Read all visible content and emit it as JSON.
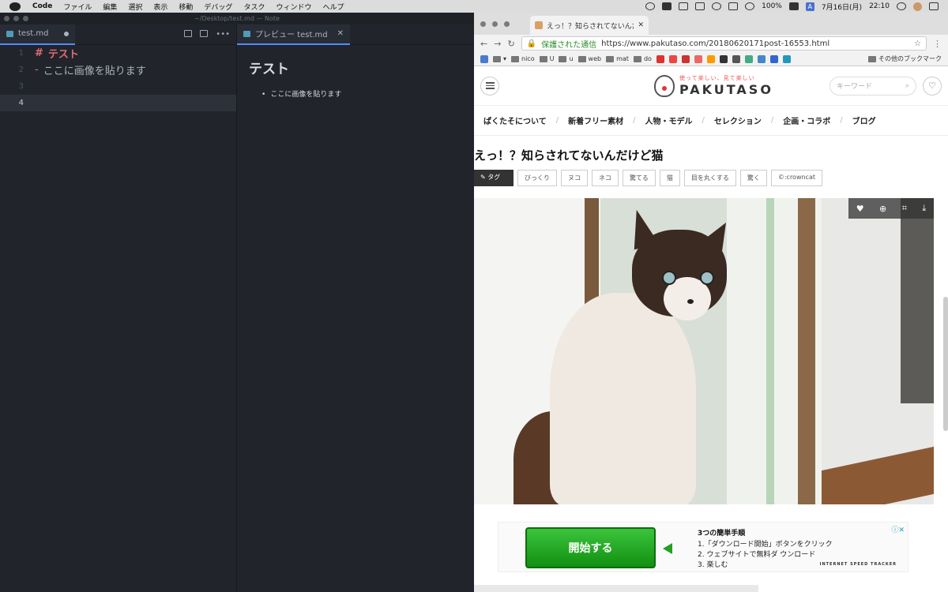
{
  "menubar": {
    "app": "Code",
    "items": [
      "ファイル",
      "編集",
      "選択",
      "表示",
      "移動",
      "デバッグ",
      "タスク",
      "ウィンドウ",
      "ヘルプ"
    ],
    "battery": "100%",
    "ime": "A",
    "date": "7月16日(月)",
    "time": "22:10"
  },
  "editor": {
    "window_title": "~/Desktop/test.md — Note",
    "tab_file": "test.md",
    "tab_preview": "プレビュー test.md",
    "lines": [
      {
        "num": "1",
        "marker": "#",
        "text": "テスト"
      },
      {
        "num": "2",
        "marker": "-",
        "text": "ここに画像を貼ります"
      },
      {
        "num": "3",
        "marker": "",
        "text": ""
      },
      {
        "num": "4",
        "marker": "",
        "text": ""
      }
    ],
    "preview_h1": "テスト",
    "preview_item": "ここに画像を貼ります"
  },
  "browser": {
    "tab_title": "えっ！？知らされてないんだけど猫",
    "secure_label": "保護された通信",
    "url": "https://www.pakutaso.com/20180620171post-16553.html",
    "bookmarks": [
      "nico",
      "U",
      "u",
      "web",
      "mat",
      "do"
    ],
    "other_bookmarks": "その他のブックマーク"
  },
  "site": {
    "tagline": "使って楽しい、見て楽しい",
    "logo": "PAKUTASO",
    "search_placeholder": "キーワード",
    "nav": [
      "ぱくたそについて",
      "新着フリー素材",
      "人物・モデル",
      "セレクション",
      "企画・コラボ",
      "ブログ"
    ],
    "post_title": "えっ！？知らされてないんだけど猫",
    "tag_label": "タグ",
    "tags": [
      "びっくり",
      "ヌコ",
      "ネコ",
      "驚てる",
      "猫",
      "目を丸くする",
      "驚く",
      "©:crowncat"
    ]
  },
  "ad": {
    "button": "開始する",
    "title": "3つの簡単手順",
    "steps": [
      "1.「ダウンロード開始」ボタンをクリック",
      "2. ウェブサイトで無料ダ ウンロード",
      "3. 楽しむ"
    ],
    "brand": "INTERNET SPEED TRACKER"
  },
  "colors": {
    "editor_bg": "#21252b",
    "accent": "#e06c75",
    "brand": "#e55555"
  }
}
